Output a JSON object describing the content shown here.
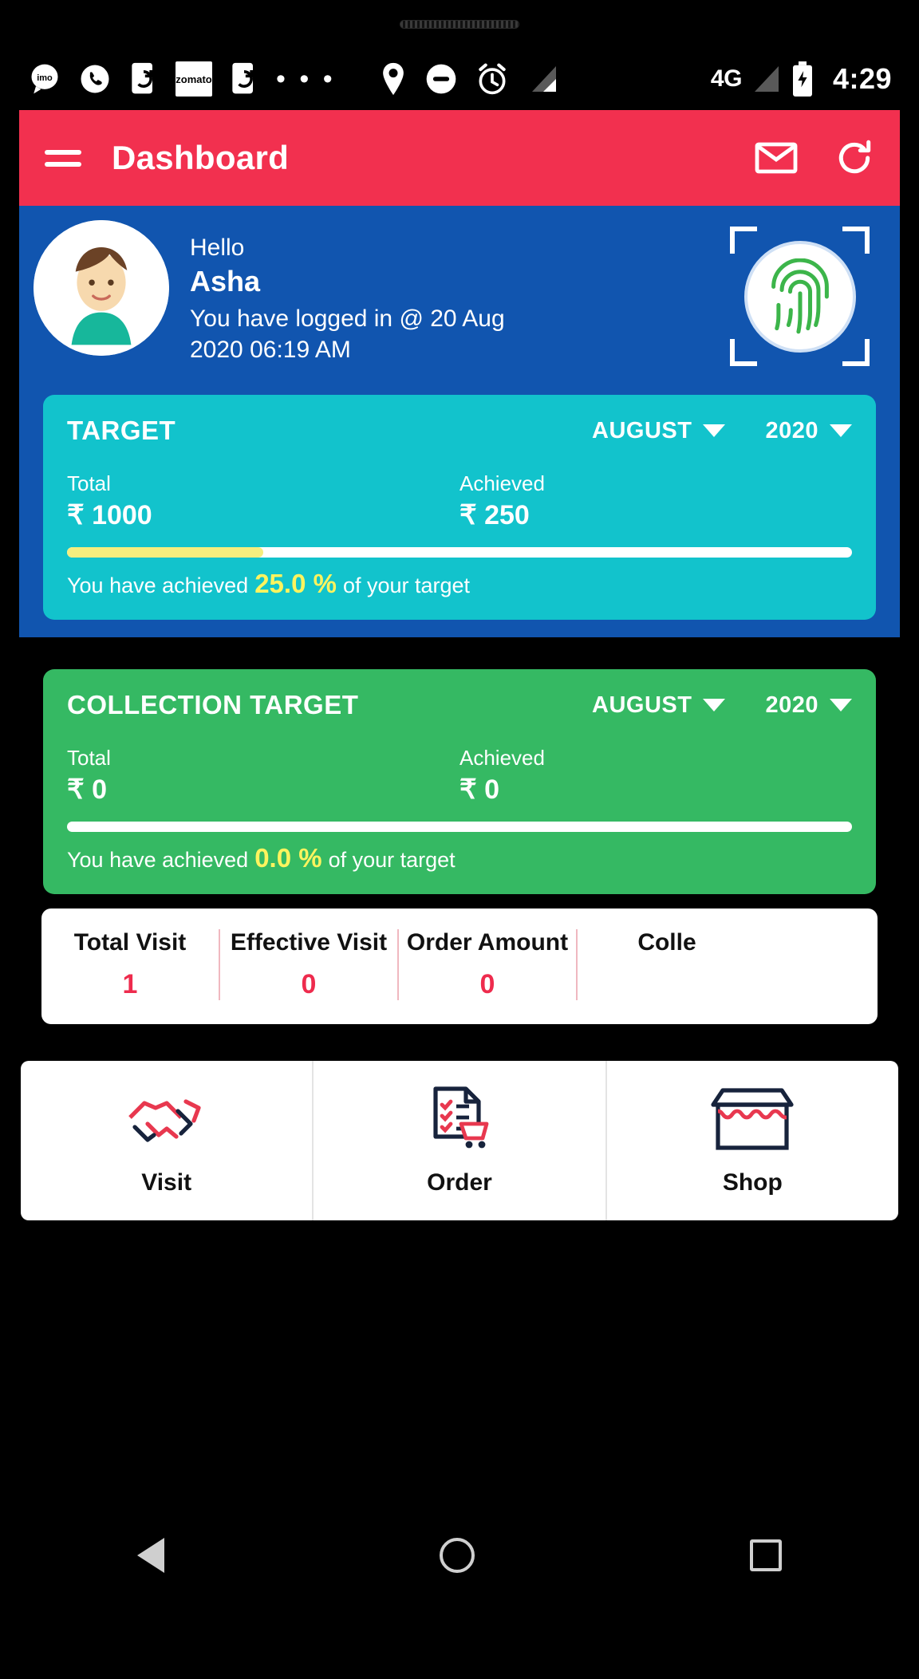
{
  "statusbar": {
    "icons": [
      "imo-icon",
      "phone-icon",
      "call-sync-icon",
      "zomato-icon",
      "call-sync-icon-2",
      "more-dots-icon",
      "location-icon",
      "do-not-disturb-icon",
      "alarm-icon",
      "signal-bars-icon",
      "signal-bars-2-icon",
      "battery-charging-icon"
    ],
    "zomato_label": "zomato",
    "imo_label": "imo",
    "dots_label": "• • •",
    "network": "4G",
    "time": "4:29"
  },
  "appbar": {
    "title": "Dashboard",
    "menu_icon": "hamburger-menu-icon",
    "mail_icon": "mail-icon",
    "refresh_icon": "refresh-icon",
    "background": "#F2304F"
  },
  "profile": {
    "greeting": "Hello",
    "name": "Asha",
    "login_text": "You have logged in @ 20 Aug 2020 06:19 AM",
    "avatar_icon": "user-avatar",
    "fingerprint_icon": "fingerprint-scan-icon",
    "background": "#1155AF"
  },
  "target_card": {
    "title": "TARGET",
    "month": "AUGUST",
    "year": "2020",
    "total_label": "Total",
    "total_value": "₹ 1000",
    "achieved_label": "Achieved",
    "achieved_value": "₹ 250",
    "progress_prefix": "You have achieved",
    "progress_percent": "25.0 %",
    "progress_suffix": "of your target",
    "progress_fill": 25,
    "background": "#12C3CC",
    "accent": "#F5EE7E"
  },
  "collection_card": {
    "title": "COLLECTION TARGET",
    "month": "AUGUST",
    "year": "2020",
    "total_label": "Total",
    "total_value": "₹ 0",
    "achieved_label": "Achieved",
    "achieved_value": "₹ 0",
    "progress_prefix": "You have achieved",
    "progress_percent": "0.0 %",
    "progress_suffix": "of your target",
    "progress_fill": 0,
    "background": "#35B963",
    "accent": "#FFF45E"
  },
  "stats": [
    {
      "label": "Total Visit",
      "value": "1"
    },
    {
      "label": "Effective Visit",
      "value": "0"
    },
    {
      "label": "Order Amount",
      "value": "0"
    },
    {
      "label": "Colle",
      "value": ""
    }
  ],
  "quick_actions": [
    {
      "label": "Visit",
      "icon": "handshake-icon"
    },
    {
      "label": "Order",
      "icon": "order-list-cart-icon"
    },
    {
      "label": "Shop",
      "icon": "shop-storefront-icon"
    }
  ],
  "navbar": {
    "back_icon": "nav-back-triangle-icon",
    "home_icon": "nav-home-circle-icon",
    "recents_icon": "nav-recents-square-icon"
  }
}
